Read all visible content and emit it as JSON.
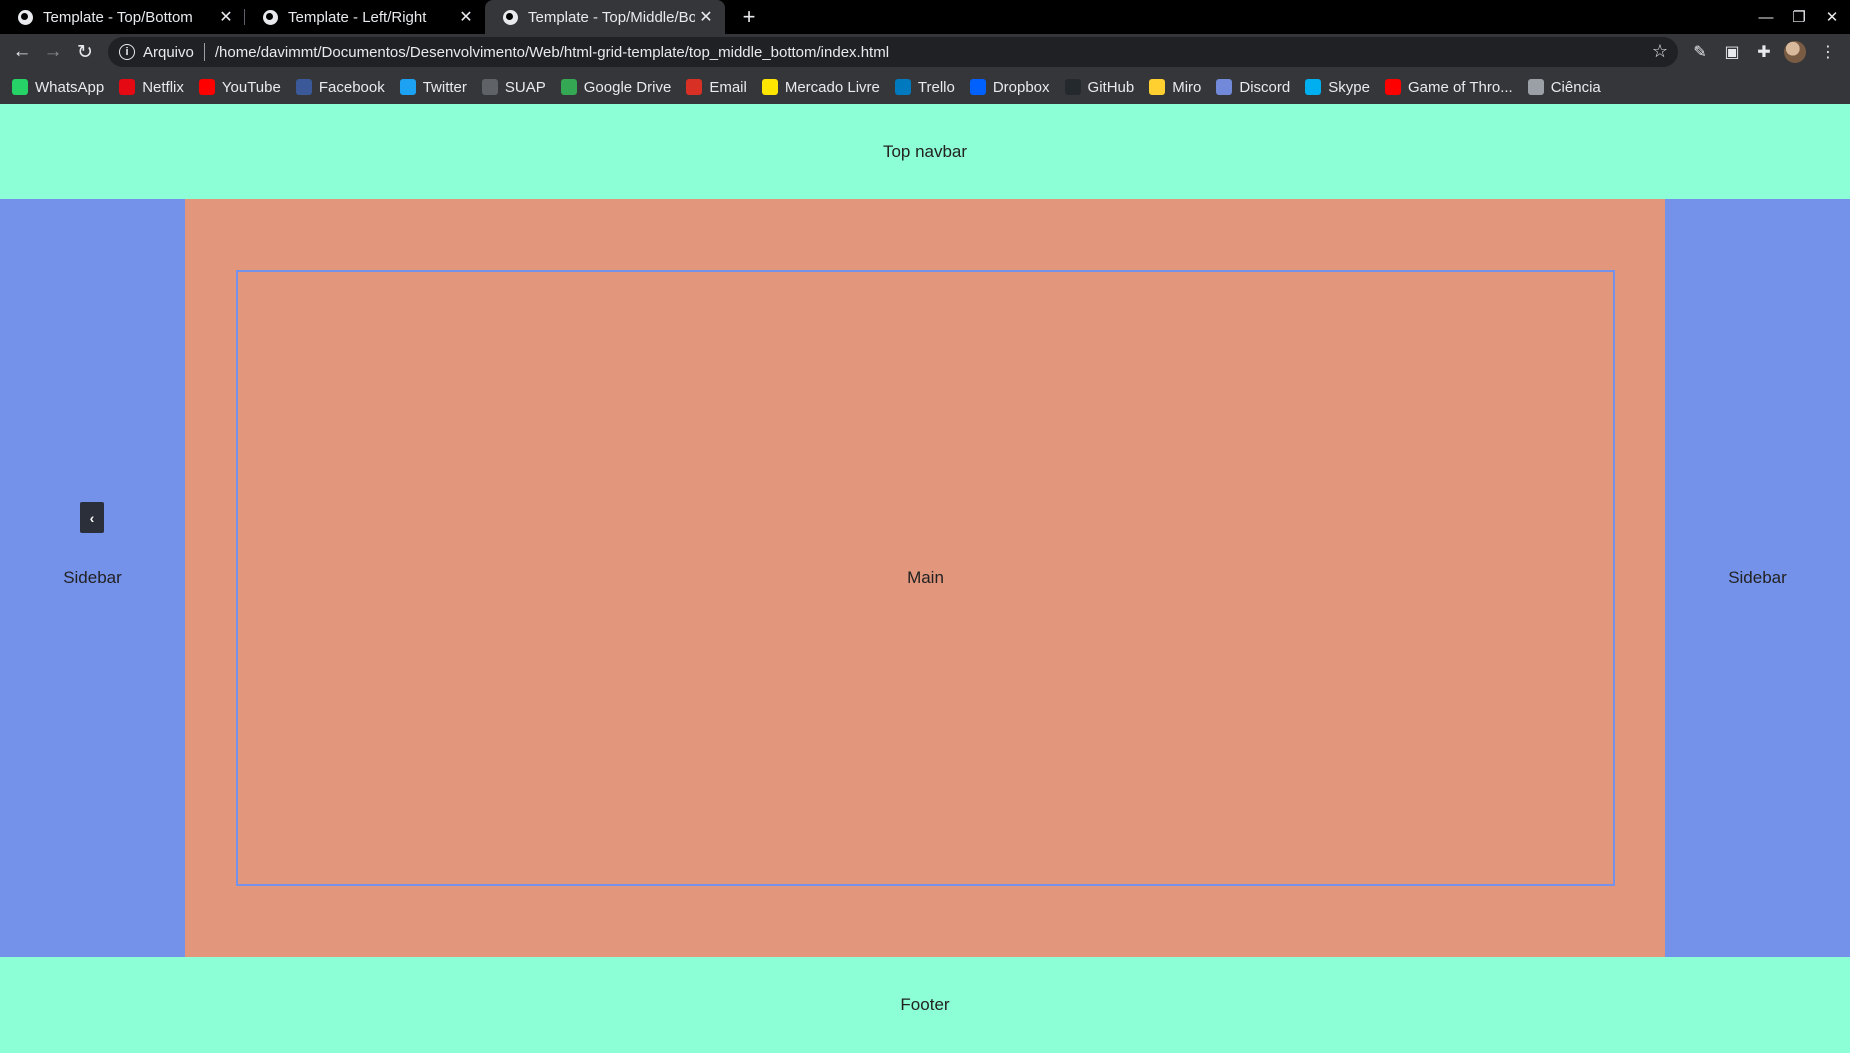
{
  "browser": {
    "tabs": [
      {
        "title": "Template - Top/Bottom",
        "active": false
      },
      {
        "title": "Template - Left/Right",
        "active": false
      },
      {
        "title": "Template - Top/Middle/Bottom",
        "active": true
      }
    ],
    "new_tab_label": "+",
    "address": {
      "security_chip": "Arquivo",
      "url": "/home/davimmt/Documentos/Desenvolvimento/Web/html-grid-template/top_middle_bottom/index.html"
    },
    "bookmarks": [
      {
        "label": "WhatsApp",
        "icon": "whatsapp-icon",
        "color": "#25d366"
      },
      {
        "label": "Netflix",
        "icon": "netflix-icon",
        "color": "#e50914"
      },
      {
        "label": "YouTube",
        "icon": "youtube-icon",
        "color": "#ff0000"
      },
      {
        "label": "Facebook",
        "icon": "facebook-icon",
        "color": "#3b5998"
      },
      {
        "label": "Twitter",
        "icon": "twitter-icon",
        "color": "#1da1f2"
      },
      {
        "label": "SUAP",
        "icon": "suap-icon",
        "color": "#5f6368"
      },
      {
        "label": "Google Drive",
        "icon": "google-drive-icon",
        "color": "#34a853"
      },
      {
        "label": "Email",
        "icon": "gmail-icon",
        "color": "#d93025"
      },
      {
        "label": "Mercado Livre",
        "icon": "mercado-livre-icon",
        "color": "#ffe600"
      },
      {
        "label": "Trello",
        "icon": "trello-icon",
        "color": "#0079bf"
      },
      {
        "label": "Dropbox",
        "icon": "dropbox-icon",
        "color": "#0061ff"
      },
      {
        "label": "GitHub",
        "icon": "github-icon",
        "color": "#24292e"
      },
      {
        "label": "Miro",
        "icon": "miro-icon",
        "color": "#ffd02f"
      },
      {
        "label": "Discord",
        "icon": "discord-icon",
        "color": "#7289da"
      },
      {
        "label": "Skype",
        "icon": "skype-icon",
        "color": "#00aff0"
      },
      {
        "label": "Game of Thro...",
        "icon": "youtube-icon",
        "color": "#ff0000"
      },
      {
        "label": "Ciência",
        "icon": "folder-icon",
        "color": "#9aa0a6"
      }
    ]
  },
  "page": {
    "top_navbar": "Top navbar",
    "left_sidebar": "Sidebar",
    "main": "Main",
    "right_sidebar": "Sidebar",
    "footer": "Footer",
    "collapse_button": "‹"
  },
  "colors": {
    "navbar_footer": "#8cffd6",
    "sidebar": "#7592ea",
    "main": "#e2967c"
  }
}
